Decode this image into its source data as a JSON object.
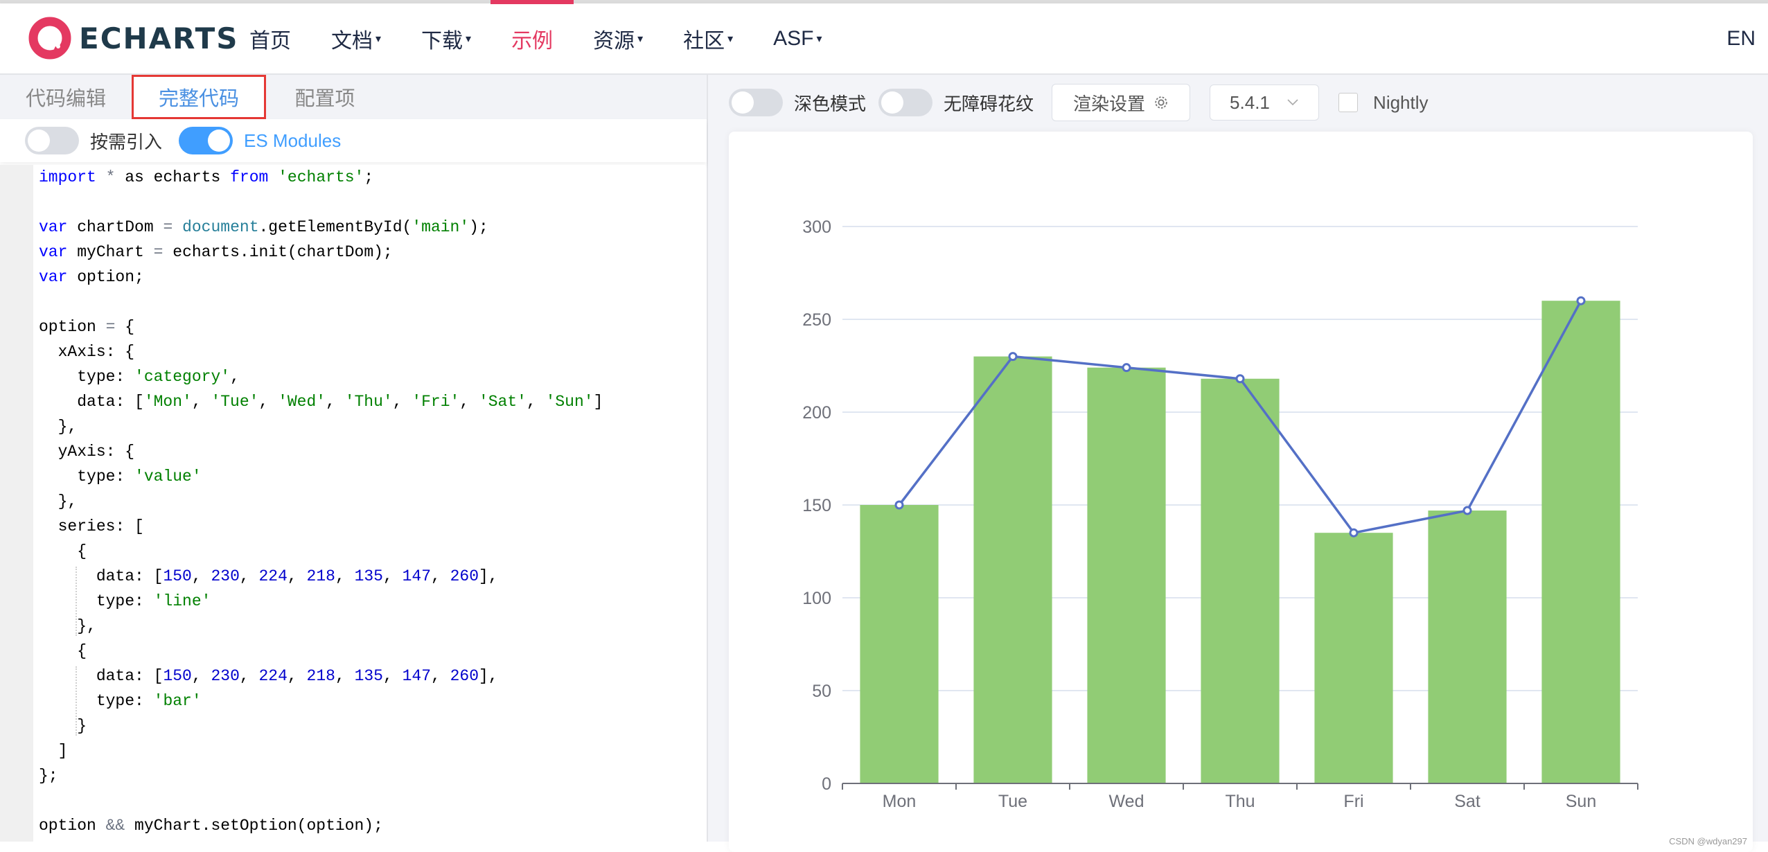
{
  "nav": {
    "logo_text": "ECHARTS",
    "items": [
      {
        "label": "首页",
        "caret": false,
        "active": false
      },
      {
        "label": "文档",
        "caret": true,
        "active": false
      },
      {
        "label": "下载",
        "caret": true,
        "active": false
      },
      {
        "label": "示例",
        "caret": false,
        "active": true
      },
      {
        "label": "资源",
        "caret": true,
        "active": false
      },
      {
        "label": "社区",
        "caret": true,
        "active": false
      },
      {
        "label": "ASF",
        "caret": true,
        "active": false
      }
    ],
    "caret_glyph": "▾",
    "lang": "EN",
    "accent_color": "#e43961"
  },
  "editor": {
    "tabs": [
      "代码编辑",
      "完整代码",
      "配置项"
    ],
    "active_tab": "完整代码",
    "toggles": [
      {
        "label": "按需引入",
        "on": false
      },
      {
        "label": "ES Modules",
        "on": true
      }
    ],
    "code_lines": [
      "import * as echarts from 'echarts';",
      "",
      "var chartDom = document.getElementById('main');",
      "var myChart = echarts.init(chartDom);",
      "var option;",
      "",
      "option = {",
      "  xAxis: {",
      "    type: 'category',",
      "    data: ['Mon', 'Tue', 'Wed', 'Thu', 'Fri', 'Sat', 'Sun']",
      "  },",
      "  yAxis: {",
      "    type: 'value'",
      "  },",
      "  series: [",
      "    {",
      "      data: [150, 230, 224, 218, 135, 147, 260],",
      "      type: 'line'",
      "    },",
      "    {",
      "      data: [150, 230, 224, 218, 135, 147, 260],",
      "      type: 'bar'",
      "    }",
      "  ]",
      "};",
      "",
      "option && myChart.setOption(option);"
    ]
  },
  "toolbar": {
    "dark_mode_label": "深色模式",
    "dark_mode_on": false,
    "decal_label": "无障碍花纹",
    "decal_on": false,
    "render_settings_label": "渲染设置",
    "version": "5.4.1",
    "nightly_label": "Nightly",
    "nightly_checked": false
  },
  "watermark": "CSDN @wdyan297",
  "chart_data": {
    "type": "bar",
    "title": "",
    "xlabel": "",
    "ylabel": "",
    "categories": [
      "Mon",
      "Tue",
      "Wed",
      "Thu",
      "Fri",
      "Sat",
      "Sun"
    ],
    "series": [
      {
        "name": "line",
        "type": "line",
        "values": [
          150,
          230,
          224,
          218,
          135,
          147,
          260
        ],
        "color": "#5470c6"
      },
      {
        "name": "bar",
        "type": "bar",
        "values": [
          150,
          230,
          224,
          218,
          135,
          147,
          260
        ],
        "color": "#91cc75"
      }
    ],
    "ylim": [
      0,
      300
    ],
    "yticks": [
      0,
      50,
      100,
      150,
      200,
      250,
      300
    ],
    "grid": true,
    "legend": "none"
  }
}
